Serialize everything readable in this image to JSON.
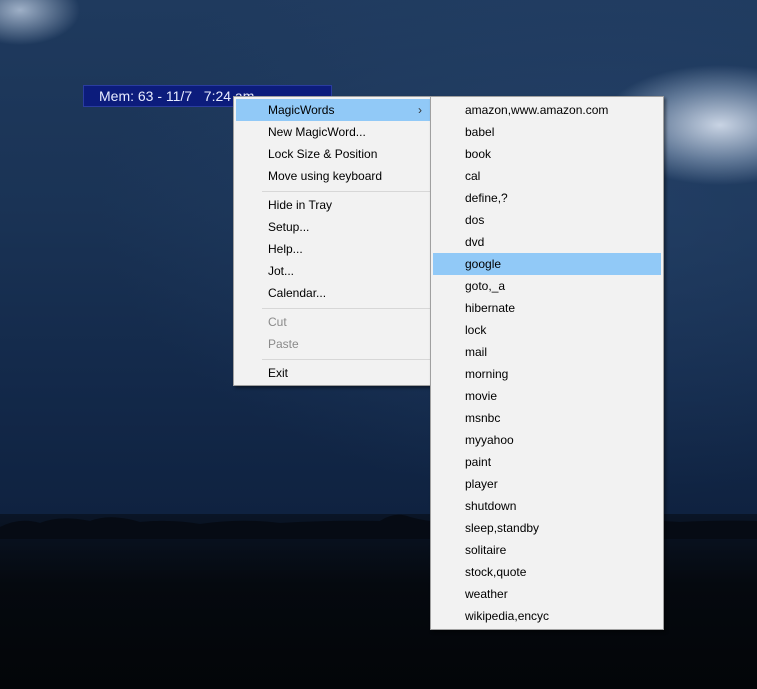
{
  "mem_bar": {
    "text": "Mem: 63 - 11/7   7:24 am"
  },
  "context_menu": {
    "items": [
      {
        "label": "MagicWords",
        "highlighted": true,
        "submenu_arrow": "›"
      },
      {
        "label": "New MagicWord..."
      },
      {
        "label": "Lock Size & Position"
      },
      {
        "label": "Move using keyboard"
      },
      {
        "label": "Hide in Tray"
      },
      {
        "label": "Setup..."
      },
      {
        "label": "Help..."
      },
      {
        "label": "Jot..."
      },
      {
        "label": "Calendar..."
      },
      {
        "label": "Cut",
        "disabled": true
      },
      {
        "label": "Paste",
        "disabled": true
      },
      {
        "label": "Exit"
      }
    ]
  },
  "submenu": {
    "items": [
      "amazon,www.amazon.com",
      "babel",
      "book",
      "cal",
      "define,?",
      "dos",
      "dvd",
      "google",
      "goto,_a",
      "hibernate",
      "lock",
      "mail",
      "morning",
      "movie",
      "msnbc",
      "myyahoo",
      "paint",
      "player",
      "shutdown",
      "sleep,standby",
      "solitaire",
      "stock,quote",
      "weather",
      "wikipedia,encyc"
    ],
    "highlighted": "google"
  },
  "colors": {
    "highlight": "#91c9f7",
    "menu_bg": "#f2f2f2",
    "mem_bar_bg": "#0c1c7c"
  }
}
